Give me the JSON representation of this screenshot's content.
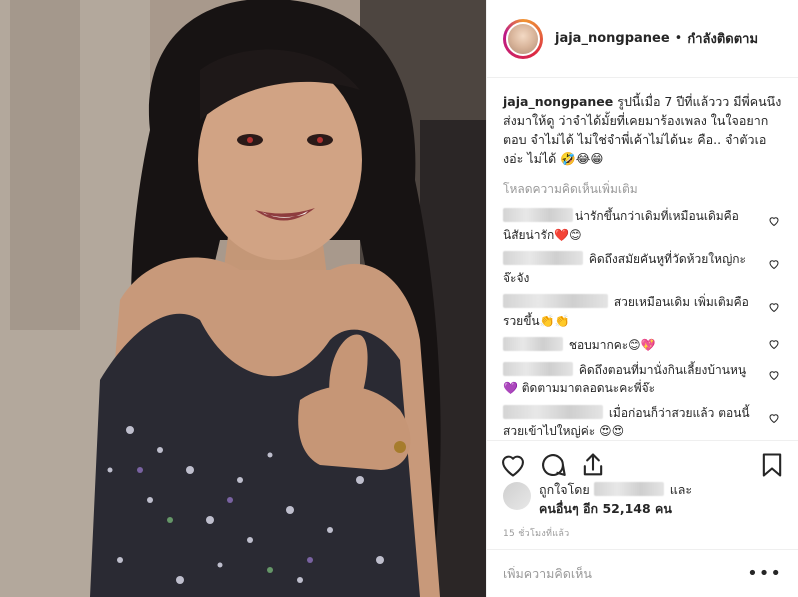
{
  "post": {
    "username": "jaja_nongpanee",
    "follow_status": "กำลังติดตาม",
    "separator": "•",
    "caption_text": "รูปนี้เมื่อ 7 ปีที่แล้ววว มีพี่คนนึงส่งมาให้ดู ว่าจำได้มั้ยที่เคยมาร้องเพลง ในใจอยากตอบ จำไม่ได้ ไม่ใช่จำพี่เค้าไม่ได้นะ คือ.. จำตัวเองอ่ะ ไม่ได้ 🤣😂😁",
    "load_more": "โหลดความคิดเห็นเพิ่มเติม",
    "time_ago": "15 ชั่วโมงที่แล้ว"
  },
  "comments": [
    {
      "text": "น่ารักขึ้นกว่าเดิมที่เหมือนเดิมคือนิสัยน่ารัก❤️😊"
    },
    {
      "text": "คิดถึงสมัยคันหูที่วัดห้วยใหญ่กะจ๊ะจัง"
    },
    {
      "text": "สวยเหมือนเดิม เพิ่มเติมคือรวยขึ้น👏👏"
    },
    {
      "text": "ชอบมากคะ😊💖"
    },
    {
      "text": "คิดถึงตอนที่มานั่งกินเลี้ยงบ้านหนู 💜 ติดตามมาตลอดนะคะพี่จ๊ะ"
    },
    {
      "text": "เมื่อก่อนก็ว่าสวยแล้ว ตอนนี้สวยเข้าไปใหญ่ค่ะ 😍😍"
    }
  ],
  "likes": {
    "prefix": "ถูกใจโดย",
    "suffix": "และ",
    "others_text": "คนอื่นๆ อีก 52,148 คน"
  },
  "add_comment": {
    "placeholder": "เพิ่มความคิดเห็น"
  },
  "icons": {
    "like": "heart-icon",
    "comment": "comment-bubble-icon",
    "share": "share-icon",
    "save": "bookmark-icon",
    "more": "more-options-icon"
  }
}
